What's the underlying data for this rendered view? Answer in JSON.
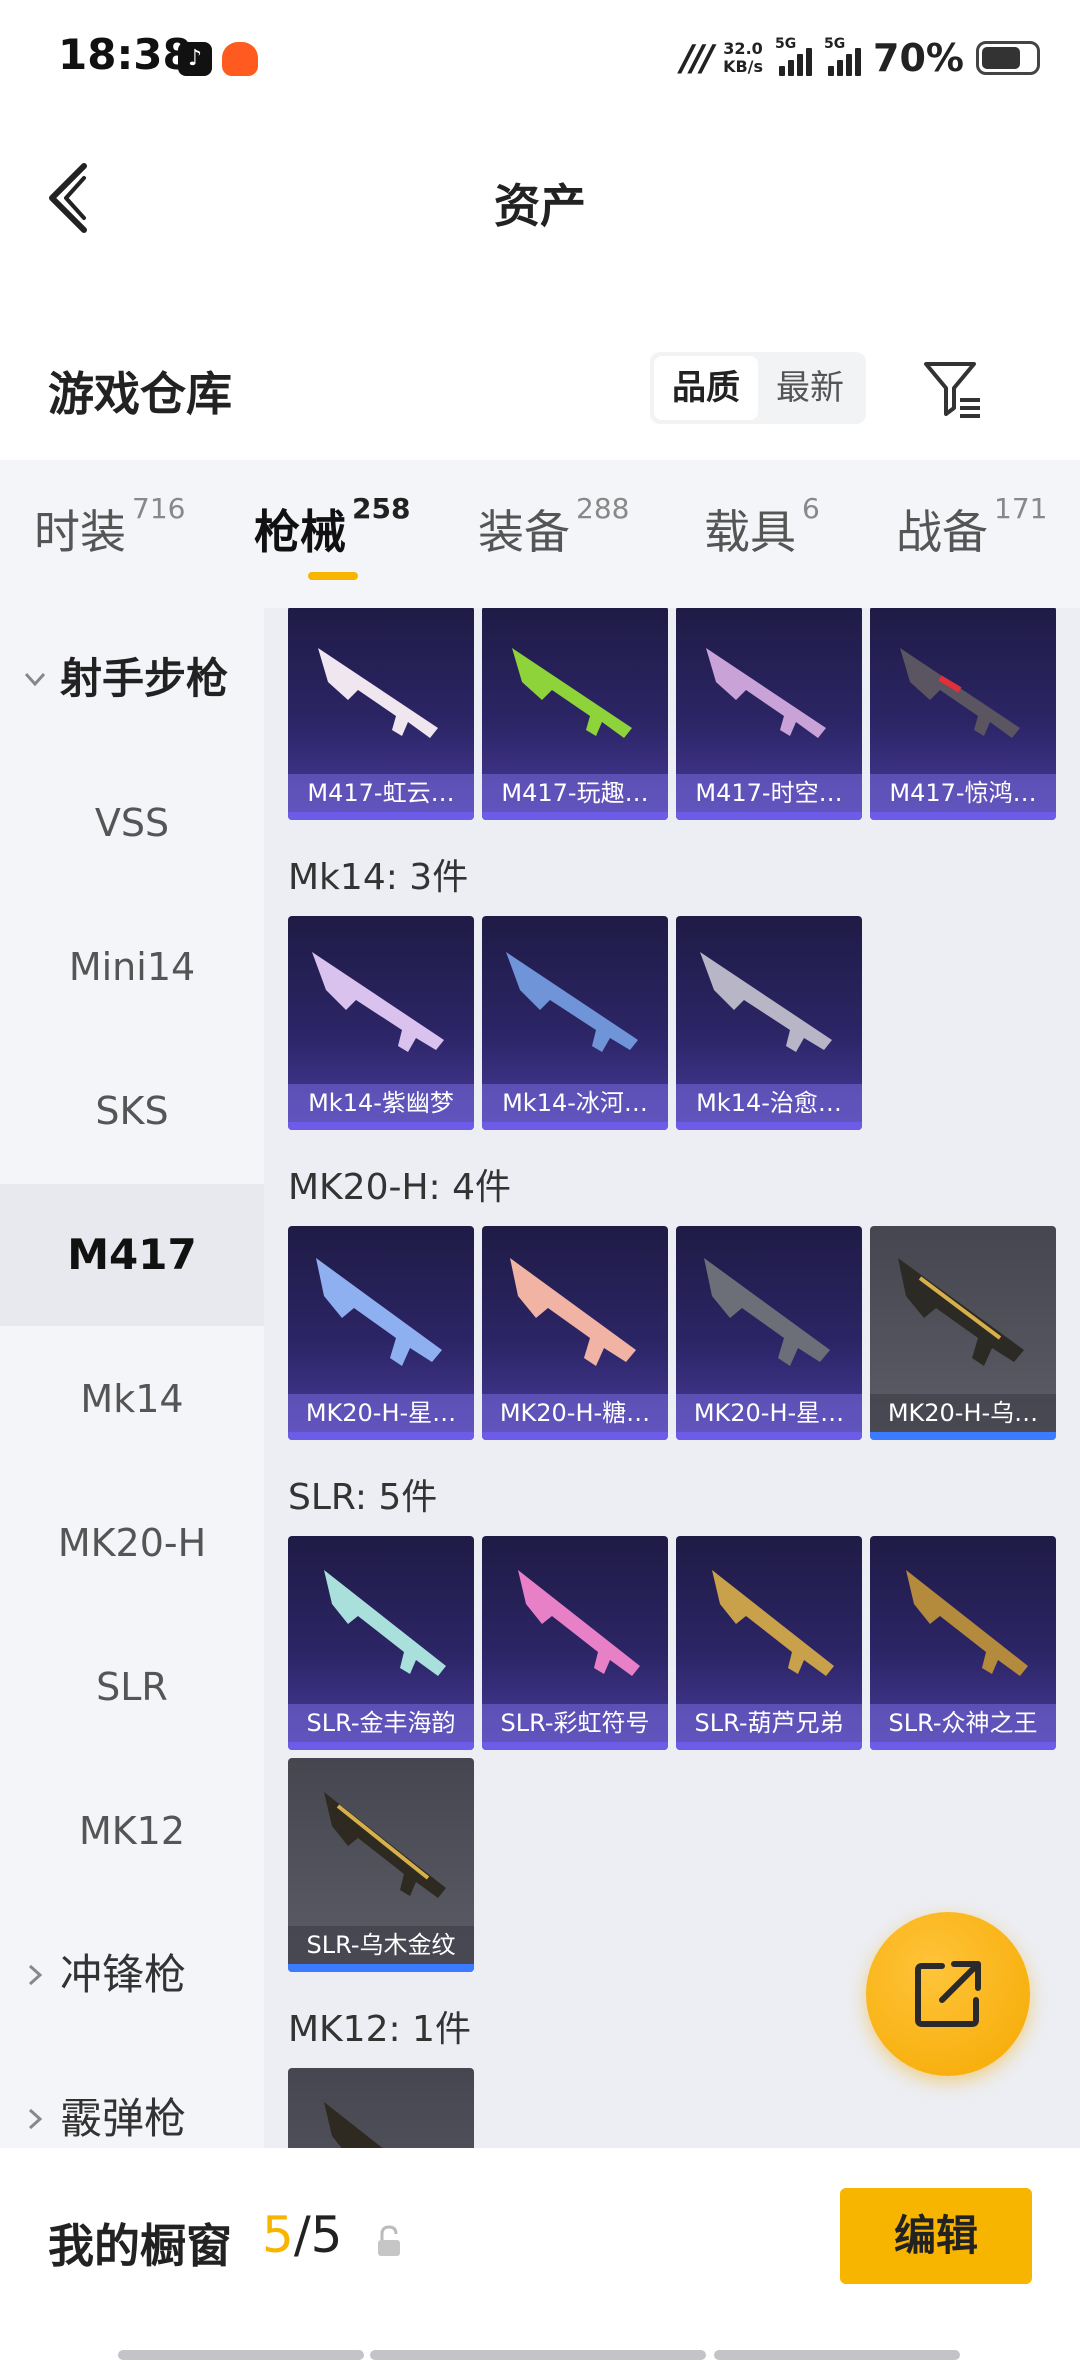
{
  "status": {
    "time": "18:38",
    "net_speed": "32.0",
    "net_unit": "KB/s",
    "sig1": "5G",
    "sig2": "5G",
    "battery": "70%"
  },
  "nav": {
    "title": "资产"
  },
  "warehouse": {
    "title": "游戏仓库",
    "sort_quality": "品质",
    "sort_newest": "最新"
  },
  "categories": [
    {
      "label": "时装",
      "count": "716"
    },
    {
      "label": "枪械",
      "count": "258"
    },
    {
      "label": "装备",
      "count": "288"
    },
    {
      "label": "载具",
      "count": "6"
    },
    {
      "label": "战备",
      "count": "171"
    }
  ],
  "sidebar": {
    "group_rifle": "射手步枪",
    "items": [
      "VSS",
      "Mini14",
      "SKS",
      "M417",
      "Mk14",
      "MK20-H",
      "SLR",
      "MK12"
    ],
    "group_smg": "冲锋枪",
    "group_shotgun": "霰弹枪"
  },
  "sections": {
    "m417": [
      "M417-虹云…",
      "M417-玩趣…",
      "M417-时空…",
      "M417-惊鸿…"
    ],
    "mk14_title": "Mk14: 3件",
    "mk14": [
      "Mk14-紫幽梦",
      "Mk14-冰河…",
      "Mk14-治愈…"
    ],
    "mk20_title": "MK20-H: 4件",
    "mk20": [
      "MK20-H-星…",
      "MK20-H-糖…",
      "MK20-H-星…",
      "MK20-H-乌…"
    ],
    "slr_title": "SLR: 5件",
    "slr": [
      "SLR-金丰海韵",
      "SLR-彩虹符号",
      "SLR-葫芦兄弟",
      "SLR-众神之王",
      "SLR-乌木金纹"
    ],
    "mk12_title": "MK12: 1件"
  },
  "bottom": {
    "label": "我的橱窗",
    "current": "5",
    "sep_total": "/5",
    "edit": "编辑"
  },
  "colors": {
    "accent": "#f7b500",
    "tile": "#2c2566"
  }
}
